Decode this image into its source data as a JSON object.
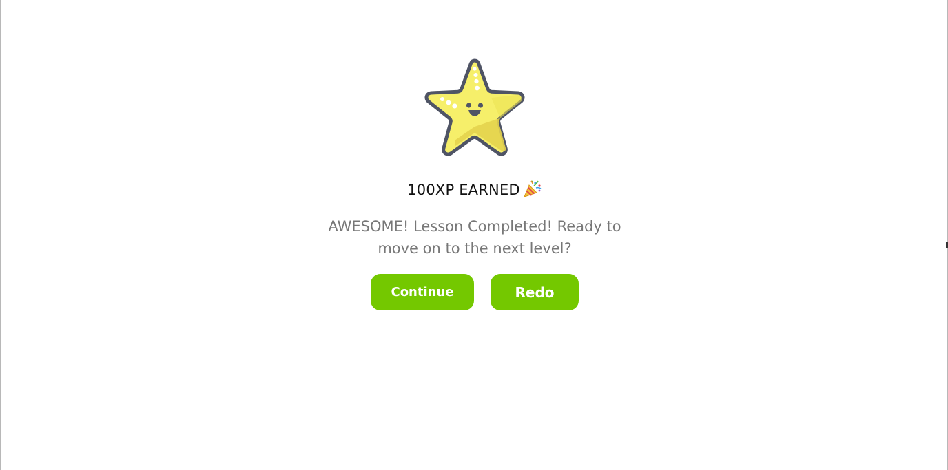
{
  "reward": {
    "xp_text": "100XP EARNED",
    "icon": "party-popper-icon"
  },
  "mascot": {
    "icon": "smiling-star-icon",
    "colors": {
      "fill": "#f6ef6a",
      "shade": "#e4d34e",
      "outline": "#4f5465"
    }
  },
  "message": {
    "line1": "AWESOME! Lesson Completed! Ready to",
    "line2": "move on to the next level?"
  },
  "actions": {
    "continue_label": "Continue",
    "redo_label": "Redo"
  },
  "colors": {
    "button": "#74c800",
    "message_text": "#777777"
  }
}
